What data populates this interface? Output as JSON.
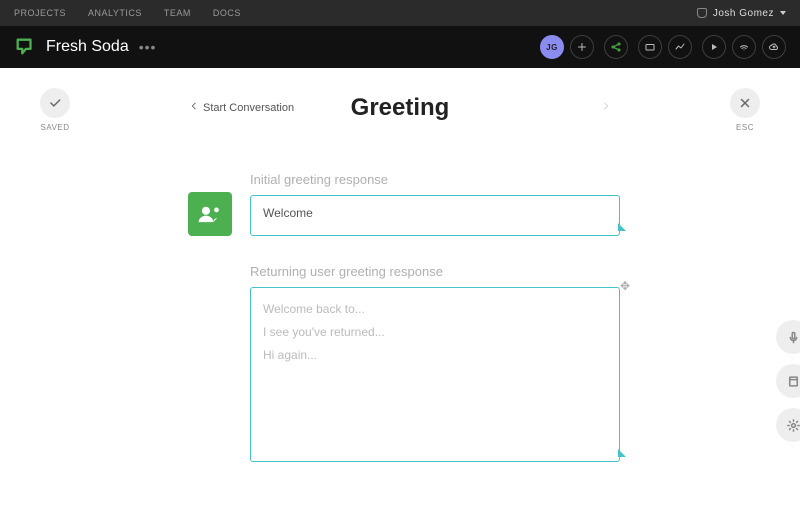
{
  "topnav": {
    "items": [
      "PROJECTS",
      "ANALYTICS",
      "TEAM",
      "DOCS"
    ],
    "user_name": "Josh Gomez"
  },
  "projbar": {
    "project_name": "Fresh Soda",
    "avatar_initials": "JG"
  },
  "editor": {
    "saved_label": "SAVED",
    "esc_label": "ESC",
    "prev_label": "Start Conversation",
    "title": "Greeting",
    "block1": {
      "label": "Initial greeting response",
      "value": "Welcome"
    },
    "block2": {
      "label": "Returning user greeting response",
      "placeholder_lines": [
        "Welcome back to...",
        "I see you've returned...",
        "Hi again..."
      ]
    }
  }
}
